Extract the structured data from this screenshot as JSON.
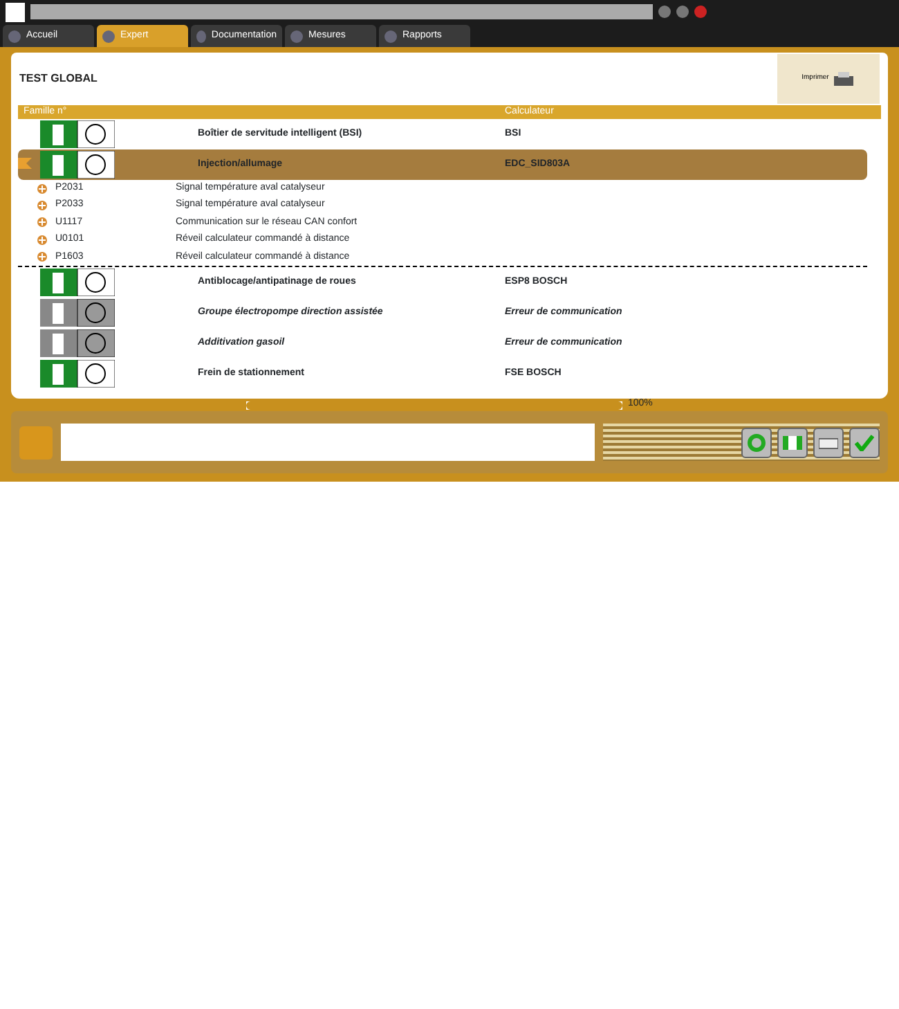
{
  "tabs": [
    {
      "label": "Accueil",
      "selected": false
    },
    {
      "label": "Expert",
      "selected": true
    },
    {
      "label": "Documentation",
      "selected": false
    },
    {
      "label": "Mesures",
      "selected": false
    },
    {
      "label": "Rapports",
      "selected": false
    }
  ],
  "panel": {
    "title": "TEST GLOBAL",
    "print_label": "Imprimer"
  },
  "table": {
    "columns": [
      "Famille n°",
      "Calculateur"
    ],
    "rows": [
      {
        "name": "Boîtier de servitude intelligent (BSI)",
        "ecu": "BSI",
        "selected": false,
        "error": false,
        "children": []
      },
      {
        "name": "Injection/allumage",
        "ecu": "EDC_SID803A",
        "selected": true,
        "error": false,
        "children": [
          {
            "code": "P2031",
            "label": "Signal température aval catalyseur"
          },
          {
            "code": "P2033",
            "label": "Signal température aval catalyseur"
          },
          {
            "code": "U1117",
            "label": "Communication sur le réseau CAN confort"
          },
          {
            "code": "U0101",
            "label": "Réveil calculateur commandé à distance"
          },
          {
            "code": "P1603",
            "label": "Réveil calculateur commandé à distance"
          }
        ]
      },
      {
        "name": "Antiblocage/antipatinage de roues",
        "ecu": "ESP8 BOSCH",
        "selected": false,
        "error": false,
        "children": []
      },
      {
        "name": "Groupe électropompe direction assistée",
        "ecu": "Erreur de communication",
        "selected": false,
        "error": true,
        "children": []
      },
      {
        "name": "Additivation gasoil",
        "ecu": "Erreur de communication",
        "selected": false,
        "error": true,
        "children": []
      },
      {
        "name": "Frein de stationnement",
        "ecu": "FSE BOSCH",
        "selected": false,
        "error": false,
        "children": []
      }
    ]
  },
  "progress": {
    "level": 1,
    "reading": "100%"
  }
}
